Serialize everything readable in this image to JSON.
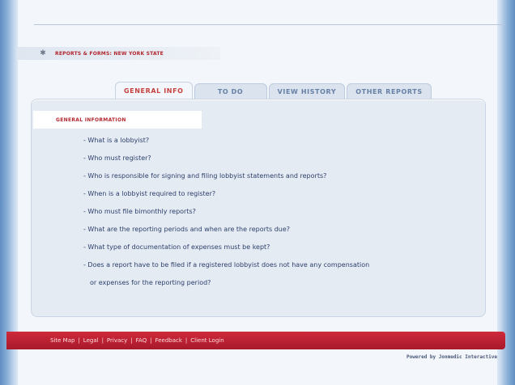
{
  "breadcrumb": {
    "icon": "star-icon",
    "text": "REPORTS & FORMS: NEW YORK STATE"
  },
  "tabs": [
    {
      "label": "GENERAL INFO",
      "active": true
    },
    {
      "label": "TO DO",
      "active": false
    },
    {
      "label": "VIEW HISTORY",
      "active": false
    },
    {
      "label": "OTHER REPORTS",
      "active": false
    }
  ],
  "panel": {
    "title": "GENERAL INFORMATION",
    "items": [
      "-  What is a lobbyist?",
      "- Who must register?",
      "- Who is responsible for signing and filing lobbyist statements and reports?",
      "- When is a lobbyist required to register?",
      "- Who must file bimonthly reports?",
      "- What are the reporting periods and when are the reports due?",
      "- What type of documentation of expenses must be kept?",
      "- Does a report have to be filed if a registered lobbyist does not have any compensation",
      "or expenses for the reporting period?"
    ]
  },
  "footer": {
    "links": [
      "Site Map",
      "Legal",
      "Privacy",
      "FAQ",
      "Feedback",
      "Client Login"
    ],
    "separator": "|",
    "powered": "Powered by Jonmedic Interactive"
  },
  "colors": {
    "accent_red": "#b3262e",
    "footer_bar": "#c32234",
    "link_blue": "#2b3f6b"
  }
}
